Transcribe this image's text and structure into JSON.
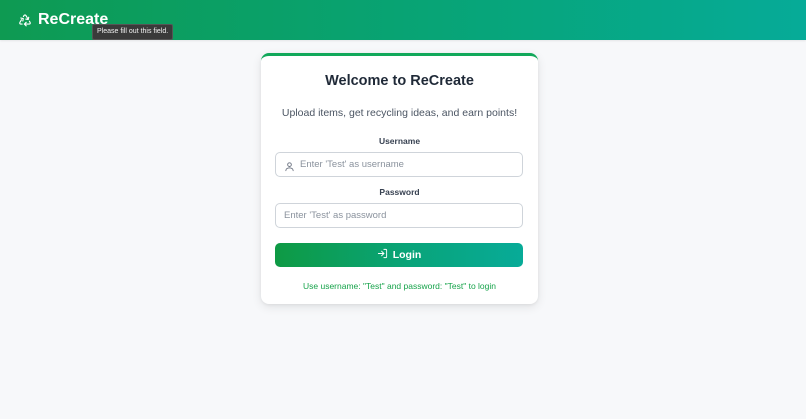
{
  "header": {
    "brand_name": "ReCreate",
    "brand_icon": "recycle-icon",
    "bg_gradient": [
      "#0e9a52",
      "#06ab98"
    ]
  },
  "tooltip": {
    "text": "Please fill out this field."
  },
  "login_card": {
    "title": "Welcome to ReCreate",
    "subtitle": "Upload items, get recycling ideas, and earn points!",
    "username_label": "Username",
    "username_placeholder": "Enter 'Test' as username",
    "username_value": "",
    "password_label": "Password",
    "password_placeholder": "Enter 'Test' as password",
    "password_value": "",
    "login_label": "Login",
    "login_icon": "login-icon",
    "hint": "Use username: \"Test\" and password: \"Test\" to login",
    "accent_color": "#16a34a"
  }
}
